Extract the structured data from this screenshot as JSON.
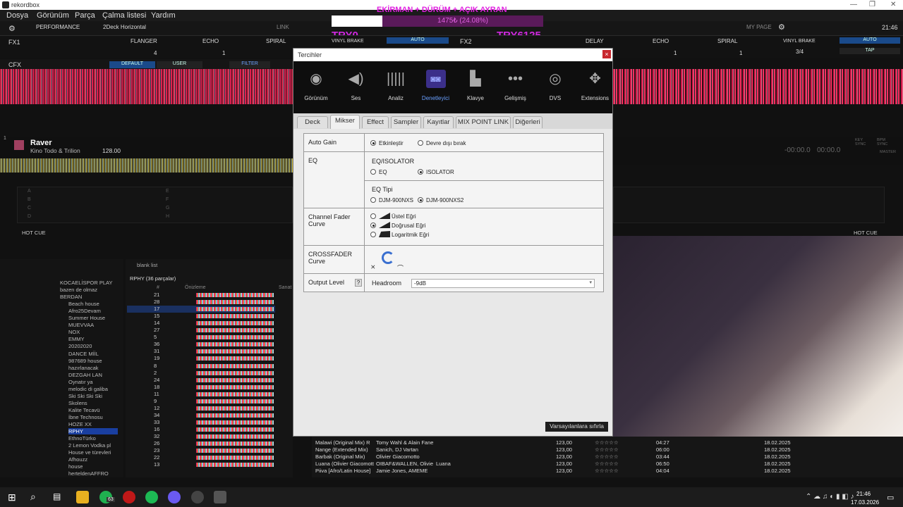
{
  "window": {
    "title": "rekordbox"
  },
  "menu": [
    "Dosya",
    "Görünüm",
    "Parça",
    "Çalma listesi",
    "Yardım"
  ],
  "stream_overlay": {
    "headline": "EKİRMAN + DÜRÜM + AÇIK AYRAN",
    "progress_text": "1475₺ (24.08%)",
    "progress": 0.2408,
    "left_label": "TRY0",
    "right_label": "TRY6125"
  },
  "toolbar": {
    "mode": "PERFORMANCE",
    "layout": "2Deck Horizontal",
    "link": "LINK",
    "my_page": "MY PAGE",
    "clock": "21:46"
  },
  "fx": {
    "fx1": "FX1",
    "fx2": "FX2",
    "effects_left": [
      "FLANGER",
      "ECHO",
      "SPIRAL",
      "VINYL BRAKE"
    ],
    "effects_right": [
      "DELAY",
      "ECHO",
      "SPIRAL",
      "VINYL BRAKE"
    ],
    "auto": "AUTO",
    "tap": "TAP",
    "beat_value": "4",
    "beat_one": "1",
    "beat_frac": "3/4",
    "cfx": "CFX",
    "default_btn": "DEFAULT",
    "user_btn": "USER",
    "filter_btn": "FILTER"
  },
  "deck1": {
    "number": "1",
    "title": "Raver",
    "artist": "Kino Todo & Trilion",
    "bpm": "128.00",
    "hot_cue": "HOT CUE",
    "pad_letters": [
      "A",
      "B",
      "C",
      "D",
      "E",
      "F",
      "G",
      "H"
    ]
  },
  "deck2": {
    "time_remaining": "-00:00.0",
    "time_elapsed": "00:00.0",
    "key_sync": "KEY SYNC",
    "bpm_sync": "BPM SYNC",
    "master": "MASTER",
    "hot_cue": "HOT CUE"
  },
  "browser": {
    "playlist_name": "blank list",
    "tracklist_header": "RPHY (36 parçalar)",
    "col_number": "#",
    "col_preview": "Önizleme",
    "col_partial": "Sanat",
    "sidebar_items": [
      "KOCAELİSPOR PLAY",
      "bazen de olmaz",
      "BERDAN",
      "Beach house",
      "Afro25Devam",
      "Summer House",
      "MUEVVAA",
      "NOX",
      "EMMY",
      "20202020",
      "DANCE MİİL",
      "987689 house",
      "hazırlanacak",
      "DEZGAH LAN",
      "Oynatır ya",
      "melodic di galiba",
      "Ski Ski Ski Ski",
      "Skolens",
      "Kalite Tecavü",
      "İbne Technosu",
      "HOZE XX",
      "RPHY",
      "EthnoTürko",
      "2 Lemon Vodka pl",
      "House ve türevleri",
      "Afhouzz",
      "house",
      "herteldenAFFRO"
    ],
    "track_numbers": [
      "21",
      "28",
      "17",
      "15",
      "14",
      "27",
      "5",
      "36",
      "31",
      "19",
      "8",
      "2",
      "24",
      "18",
      "11",
      "9",
      "12",
      "34",
      "33",
      "16",
      "32",
      "26",
      "23",
      "22",
      "13"
    ],
    "playing_index_label": "1"
  },
  "bottom_tracks": [
    {
      "title": "Malawi (Original Mix) R",
      "artist": "Tomy Wahl & Alain Fane",
      "album": "",
      "bpm": "123,00",
      "time": "04:27",
      "date": "18.02.2025"
    },
    {
      "title": "Nange (Extended Mix)",
      "artist": "Sanich, DJ Vartan",
      "album": "",
      "bpm": "123,00",
      "time": "06:00",
      "date": "18.02.2025"
    },
    {
      "title": "Barbak (Original Mix)",
      "artist": "Olivier Giacomotto",
      "album": "",
      "bpm": "123,00",
      "time": "03:44",
      "date": "18.02.2025"
    },
    {
      "title": "Luana (Olivier Giacomott",
      "artist": "OIBAF&WALLEN, Olivie",
      "album": "Luana",
      "bpm": "123,00",
      "time": "06:50",
      "date": "18.02.2025"
    },
    {
      "title": "Piiva [Afro/Latin House]",
      "artist": "Jamie Jones, AMEME",
      "album": "",
      "bpm": "123,00",
      "time": "04:04",
      "date": "18.02.2025"
    }
  ],
  "dialog": {
    "title": "Tercihler",
    "close": "×",
    "categories": [
      {
        "label": "Görünüm",
        "icon": "eye-icon",
        "glyph": "◉"
      },
      {
        "label": "Ses",
        "icon": "speaker-icon",
        "glyph": "◀)"
      },
      {
        "label": "Analiz",
        "icon": "waveform-icon",
        "glyph": "|||||"
      },
      {
        "label": "Denetleyici",
        "icon": "controller-icon",
        "glyph": "◙◙"
      },
      {
        "label": "Klavye",
        "icon": "keyboard-icon",
        "glyph": "▙"
      },
      {
        "label": "Gelişmiş",
        "icon": "dots-icon",
        "glyph": "•••"
      },
      {
        "label": "DVS",
        "icon": "vinyl-icon",
        "glyph": "◎"
      },
      {
        "label": "Extensions",
        "icon": "extensions-icon",
        "glyph": "✥"
      }
    ],
    "active_category": "Denetleyici",
    "tabs": [
      "Deck",
      "Mikser",
      "Effect",
      "Sampler",
      "Kayıtlar",
      "MIX POINT LINK",
      "Diğerleri"
    ],
    "active_tab": "Mikser",
    "auto_gain": {
      "label": "Auto Gain",
      "opt_on": "Etkinleştir",
      "opt_off": "Devre dışı bırak",
      "selected": "Etkinleştir"
    },
    "eq": {
      "label": "EQ",
      "isolator_heading": "EQ/ISOLATOR",
      "opt_eq": "EQ",
      "opt_isolator": "ISOLATOR",
      "selected": "ISOLATOR",
      "type_heading": "EQ Tipi",
      "type_a": "DJM-900NXS",
      "type_b": "DJM-900NXS2",
      "type_selected": "DJM-900NXS2"
    },
    "channel_fader": {
      "label": "Channel Fader Curve",
      "opt_exp": "Üstel Eğri",
      "opt_linear": "Doğrusal Eğri",
      "opt_log": "Logaritmik Eğri",
      "selected": "Doğrusal Eğri"
    },
    "crossfader": {
      "label": "CROSSFADER Curve"
    },
    "output_level": {
      "label": "Output Level",
      "help": "?",
      "headroom_label": "Headroom",
      "headroom_value": "-9dB"
    },
    "reset_button": "Varsayılanlara sıfırla"
  },
  "taskbar": {
    "time": "21:46",
    "date": "17.03.2026",
    "badge": "63"
  },
  "colors": {
    "accent_blue": "#3a8cff",
    "overlay_magenta": "#d028e0",
    "waveform_red": "#e02050",
    "close_red": "#c8282e"
  }
}
